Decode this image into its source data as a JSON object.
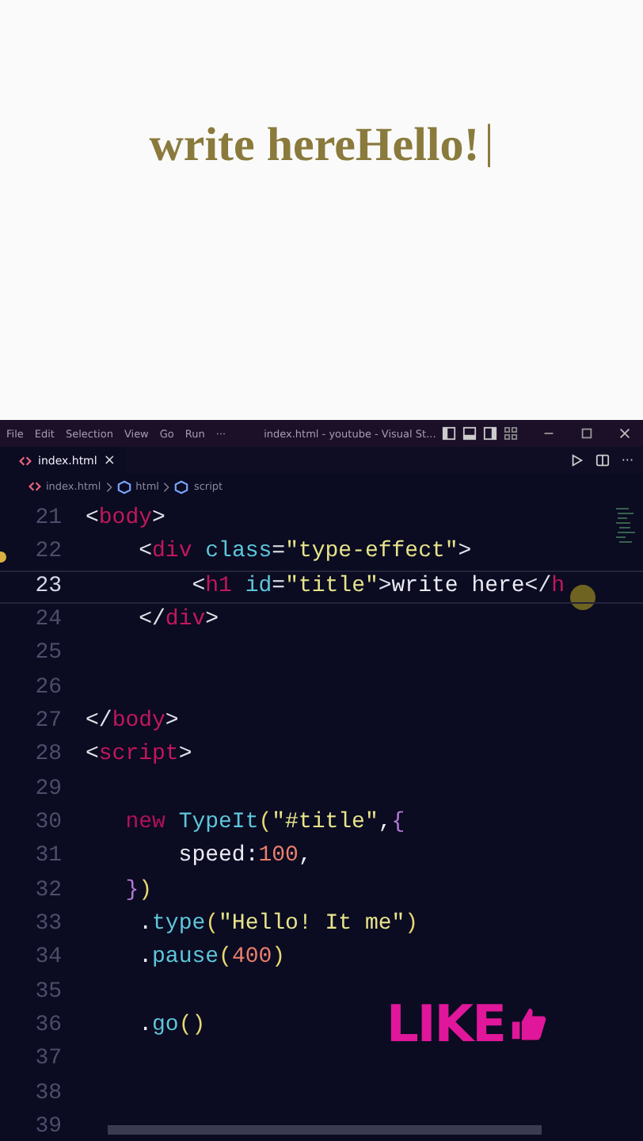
{
  "preview": {
    "heading": "write hereHello!",
    "cursor": "|"
  },
  "titlebar": {
    "menus": [
      "File",
      "Edit",
      "Selection",
      "View",
      "Go",
      "Run",
      "···"
    ],
    "title": "index.html - youtube - Visual St..."
  },
  "tabs": [
    {
      "label": "index.html",
      "close": "×",
      "selected": true
    }
  ],
  "tab_actions": {
    "more": "···"
  },
  "breadcrumb": [
    "index.html",
    "html",
    "script"
  ],
  "code_lines": [
    {
      "number": "21",
      "active": false,
      "tokens": [
        {
          "kind": "punct",
          "text": "<"
        },
        {
          "kind": "tag",
          "text": "body"
        },
        {
          "kind": "punct",
          "text": ">"
        }
      ]
    },
    {
      "number": "22",
      "active": false,
      "tokens": [
        {
          "kind": "punct",
          "text": "    <"
        },
        {
          "kind": "tag",
          "text": "div"
        },
        {
          "kind": "attr",
          "text": " class"
        },
        {
          "kind": "punct",
          "text": "="
        },
        {
          "kind": "string",
          "text": "\"type-effect\""
        },
        {
          "kind": "punct",
          "text": ">"
        }
      ]
    },
    {
      "number": "23",
      "active": true,
      "tokens": [
        {
          "kind": "punct",
          "text": "        <"
        },
        {
          "kind": "tag",
          "text": "h1"
        },
        {
          "kind": "attr",
          "text": " id"
        },
        {
          "kind": "punct",
          "text": "="
        },
        {
          "kind": "string",
          "text": "\"title\""
        },
        {
          "kind": "punct",
          "text": ">"
        },
        {
          "kind": "plain",
          "text": "write here"
        },
        {
          "kind": "punct",
          "text": "</"
        },
        {
          "kind": "tag",
          "text": "h"
        }
      ]
    },
    {
      "number": "24",
      "active": false,
      "tokens": [
        {
          "kind": "punct",
          "text": "    </"
        },
        {
          "kind": "tag",
          "text": "div"
        },
        {
          "kind": "punct",
          "text": ">"
        }
      ]
    },
    {
      "number": "25",
      "active": false
    },
    {
      "number": "26",
      "active": false
    },
    {
      "number": "27",
      "active": false,
      "tokens": [
        {
          "kind": "punct",
          "text": "</"
        },
        {
          "kind": "tag",
          "text": "body"
        },
        {
          "kind": "punct",
          "text": ">"
        }
      ]
    },
    {
      "number": "28",
      "active": false,
      "tokens": [
        {
          "kind": "punct",
          "text": "<"
        },
        {
          "kind": "tag",
          "text": "script"
        },
        {
          "kind": "punct",
          "text": ">"
        }
      ]
    },
    {
      "number": "29",
      "active": false
    },
    {
      "number": "30",
      "active": false,
      "tokens": [
        {
          "kind": "keyword",
          "text": "   new"
        },
        {
          "kind": "func",
          "text": " TypeIt"
        },
        {
          "kind": "bracket",
          "text": "("
        },
        {
          "kind": "string",
          "text": "\"#title\""
        },
        {
          "kind": "plain",
          "text": ","
        },
        {
          "kind": "brace",
          "text": "{"
        }
      ]
    },
    {
      "number": "31",
      "active": false,
      "tokens": [
        {
          "kind": "plain",
          "text": "       speed:"
        },
        {
          "kind": "num",
          "text": "100"
        },
        {
          "kind": "plain",
          "text": ","
        }
      ]
    },
    {
      "number": "32",
      "active": false,
      "tokens": [
        {
          "kind": "brace",
          "text": "   }"
        },
        {
          "kind": "bracket",
          "text": ")"
        }
      ]
    },
    {
      "number": "33",
      "active": false,
      "tokens": [
        {
          "kind": "plain",
          "text": "    ."
        },
        {
          "kind": "func",
          "text": "type"
        },
        {
          "kind": "bracket",
          "text": "("
        },
        {
          "kind": "string",
          "text": "\"Hello! It me\""
        },
        {
          "kind": "bracket",
          "text": ")"
        }
      ]
    },
    {
      "number": "34",
      "active": false,
      "tokens": [
        {
          "kind": "plain",
          "text": "    ."
        },
        {
          "kind": "func",
          "text": "pause"
        },
        {
          "kind": "bracket",
          "text": "("
        },
        {
          "kind": "num",
          "text": "400"
        },
        {
          "kind": "bracket",
          "text": ")"
        }
      ]
    },
    {
      "number": "35",
      "active": false
    },
    {
      "number": "36",
      "active": false,
      "tokens": [
        {
          "kind": "plain",
          "text": "    ."
        },
        {
          "kind": "func",
          "text": "go"
        },
        {
          "kind": "bracket",
          "text": "()"
        }
      ]
    },
    {
      "number": "37",
      "active": false
    },
    {
      "number": "38",
      "active": false
    },
    {
      "number": "39",
      "active": false
    }
  ],
  "sticker": {
    "text": "LIKE"
  }
}
